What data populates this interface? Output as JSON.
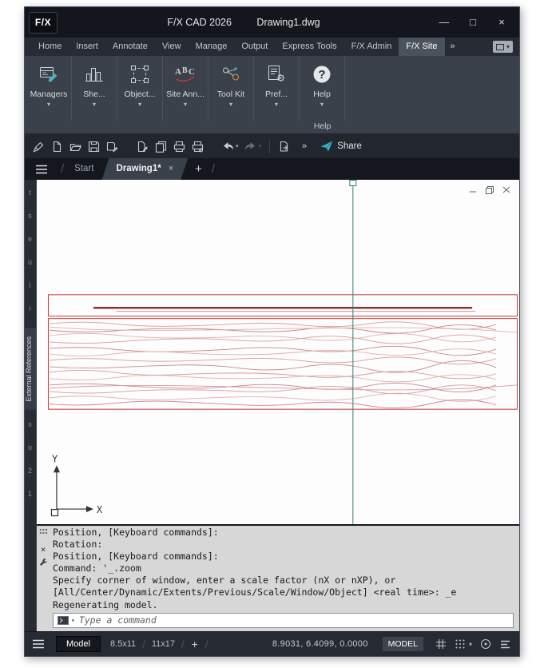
{
  "window": {
    "logo_text": "F/X",
    "title_app": "F/X CAD 2026",
    "title_doc": "Drawing1.dwg",
    "controls": {
      "minimize": "—",
      "maximize": "□",
      "close": "×"
    }
  },
  "glyphs": {
    "caret_down": "▾",
    "overflow": "»",
    "plus": "+",
    "slash": "/",
    "close": "×"
  },
  "ribbon_tabs": {
    "items": [
      {
        "label": "Home"
      },
      {
        "label": "Insert"
      },
      {
        "label": "Annotate"
      },
      {
        "label": "View"
      },
      {
        "label": "Manage"
      },
      {
        "label": "Output"
      },
      {
        "label": "Express Tools"
      },
      {
        "label": "F/X Admin"
      },
      {
        "label": "F/X Site"
      }
    ],
    "active_tab": "F/X Site"
  },
  "ribbon_panel": {
    "buttons": [
      {
        "label": "Managers",
        "icon": "managers-icon"
      },
      {
        "label": "She...",
        "icon": "sheets-icon"
      },
      {
        "label": "Object...",
        "icon": "objects-icon"
      },
      {
        "label": "Site Ann...",
        "icon": "site-annotation-icon"
      },
      {
        "label": "Tool Kit",
        "icon": "toolkit-icon"
      },
      {
        "label": "Pref...",
        "icon": "preferences-icon"
      },
      {
        "label": "Help",
        "icon": "help-icon"
      }
    ],
    "group_label": "Help"
  },
  "quick_access": {
    "icons": [
      "pencil-icon",
      "new-file-icon",
      "open-folder-icon",
      "save-icon",
      "save-as-icon",
      "page-pencil-icon",
      "copy-icon",
      "print-icon",
      "batch-print-icon",
      "undo-icon",
      "redo-icon",
      "sheet-arrow-icon",
      "paper-plane-icon"
    ],
    "share_label": "Share"
  },
  "file_tabs": {
    "items": [
      {
        "label": "Start"
      },
      {
        "label": "Drawing1*"
      }
    ],
    "active_tab": "Drawing1*"
  },
  "side_panel": {
    "vertical_label": "External References",
    "edge_fragments": "t\ns\ne\nu\nl\ni\no\nl\nl\nN\ns\no\n2\n1"
  },
  "canvas": {
    "ucs_x": "X",
    "ucs_y": "Y"
  },
  "command_line": {
    "history": [
      "Position, [Keyboard commands]:",
      "Rotation:",
      "Position, [Keyboard commands]:",
      "Command: '_.zoom",
      "Specify corner of window, enter a scale factor (nX or nXP), or",
      "[All/Center/Dynamic/Extents/Previous/Scale/Window/Object] <real time>: _e",
      "Regenerating model."
    ],
    "input_placeholder": "Type a command"
  },
  "status_bar": {
    "model_tab": "Model",
    "layouts": [
      "8.5x11",
      "11x17"
    ],
    "coordinates": "8.9031, 6.4099, 0.0000",
    "space_button": "MODEL"
  },
  "colors": {
    "drawing_red": "#c23a3a",
    "drawing_dark_red": "#7d1f1f",
    "hatch_red": "#d99a9a",
    "crosshair_teal": "#2f7d72",
    "share_teal": "#38b1c6",
    "ribbon_active_tab": "#4a535d"
  }
}
